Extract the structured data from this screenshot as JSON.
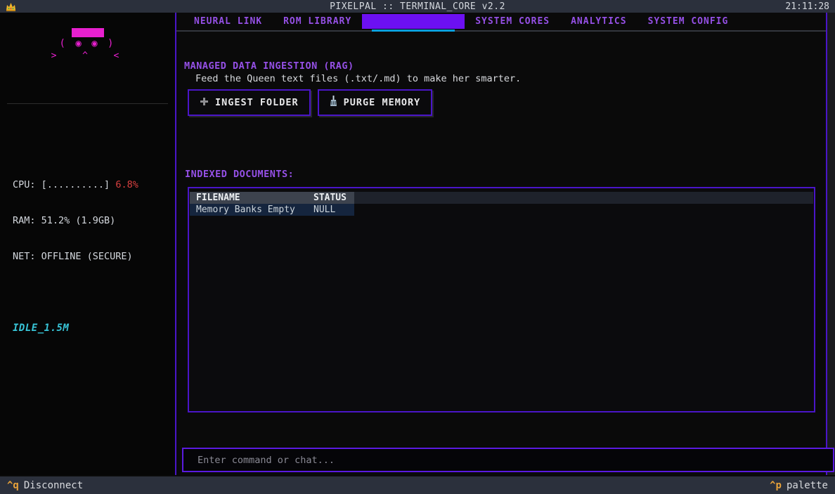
{
  "titlebar": {
    "title": "PIXELPAL :: TERMINAL_CORE v2.2",
    "clock": "21:11:28"
  },
  "tabs": [
    {
      "label": "NEURAL LINK",
      "selected": false
    },
    {
      "label": "ROM LIBRARY",
      "selected": false
    },
    {
      "label": "",
      "selected": true
    },
    {
      "label": "SYSTEM CORES",
      "selected": false
    },
    {
      "label": "ANALYTICS",
      "selected": false
    },
    {
      "label": "SYSTEM CONFIG",
      "selected": false
    }
  ],
  "sidebar": {
    "mascot": {
      "face_line": "( ◉ ◉ )",
      "mouth_line": ">  ^  <"
    },
    "stats": {
      "cpu_label": "CPU: [..........] ",
      "cpu_value": "6.8%",
      "ram_line": "RAM: 51.2% (1.9GB)",
      "net_line": "NET: OFFLINE (SECURE)",
      "idle": "IDLE_1.5M"
    }
  },
  "main": {
    "section_title": "MANAGED DATA INGESTION (RAG)",
    "section_desc": "Feed the Queen text files (.txt/.md) to make her smarter.",
    "buttons": {
      "ingest_label": "INGEST FOLDER",
      "purge_label": "PURGE MEMORY"
    },
    "documents": {
      "heading": "INDEXED DOCUMENTS:",
      "columns": [
        "FILENAME",
        "STATUS"
      ],
      "rows": [
        {
          "filename": "Memory Banks Empty",
          "status": "NULL"
        }
      ]
    },
    "input_placeholder": "Enter command or chat..."
  },
  "statusbar": {
    "left_key": "^q",
    "left_label": "Disconnect",
    "right_key": "^p",
    "right_label": "palette"
  },
  "colors": {
    "accent_purple": "#9550e6",
    "selected_tab_purple": "#6c10f2",
    "border_purple": "#4a15c8",
    "mascot_magenta": "#e820cf",
    "underline_cyan": "#0aa0dd",
    "idle_cyan": "#38c5d8",
    "hotkey_orange": "#e8a23a",
    "cpu_red": "#d94040",
    "bar_slate": "#2b303c",
    "row_highlight_blue": "#15253e",
    "header_gray": "#3d434e"
  }
}
